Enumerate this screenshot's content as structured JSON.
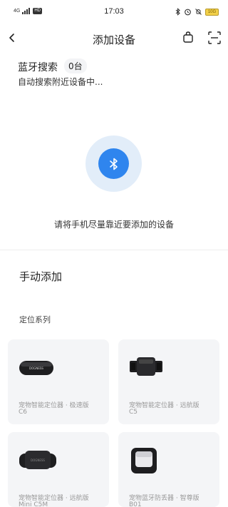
{
  "status_bar": {
    "signal": "4G",
    "hd": "HD",
    "time": "17:03",
    "battery": "10G"
  },
  "nav": {
    "title": "添加设备"
  },
  "bluetooth": {
    "title": "蓝牙搜索",
    "count": "0台",
    "subtitle": "自动搜索附近设备中...",
    "hint": "请将手机尽量靠近要添加的设备"
  },
  "manual": {
    "title": "手动添加",
    "series": "定位系列",
    "products": [
      {
        "name": "宠物智能定位器 · 极速版",
        "model": "C6"
      },
      {
        "name": "宠物智能定位器 · 远航版",
        "model": "C5"
      },
      {
        "name": "宠物智能定位器 · 远航版",
        "model": "Mini C5M"
      },
      {
        "name": "宠物蓝牙防丢器 · 智尊版",
        "model": "B01"
      }
    ]
  },
  "icons": {
    "back": "chevron-left-icon",
    "bag": "shopping-bag-icon",
    "scan": "scan-icon",
    "bluetooth": "bluetooth-icon"
  },
  "colors": {
    "accent": "#2f85ee",
    "accent_light": "#e2edf9",
    "card_bg": "#f4f5f7"
  }
}
